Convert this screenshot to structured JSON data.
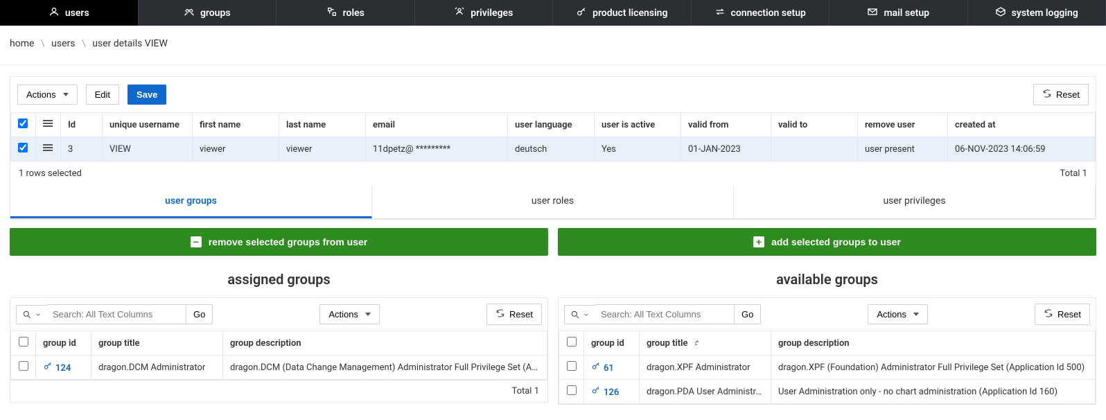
{
  "nav": {
    "items": [
      {
        "label": "users",
        "active": true
      },
      {
        "label": "groups"
      },
      {
        "label": "roles"
      },
      {
        "label": "privileges"
      },
      {
        "label": "product licensing"
      },
      {
        "label": "connection setup"
      },
      {
        "label": "mail setup"
      },
      {
        "label": "system logging"
      }
    ]
  },
  "breadcrumb": {
    "home": "home",
    "users": "users",
    "current": "user details VIEW"
  },
  "toolbar": {
    "actions": "Actions",
    "edit": "Edit",
    "save": "Save",
    "reset": "Reset"
  },
  "user_table": {
    "headers": {
      "id": "Id",
      "username": "unique username",
      "first": "first name",
      "last": "last name",
      "email": "email",
      "lang": "user language",
      "active": "user is active",
      "from": "valid from",
      "to": "valid to",
      "remove": "remove user",
      "created": "created at"
    },
    "row": {
      "id": "3",
      "username": "VIEW",
      "first": "viewer",
      "last": "viewer",
      "email": "11dpetz@ *********",
      "lang": "deutsch",
      "active": "Yes",
      "from": "01-JAN-2023",
      "to": "",
      "remove": "user present",
      "created": "06-NOV-2023 14:06:59"
    },
    "status_left": "1 rows selected",
    "status_right": "Total 1"
  },
  "subtabs": {
    "groups": "user groups",
    "roles": "user roles",
    "privileges": "user privileges"
  },
  "green": {
    "remove": "remove selected groups from user",
    "add": "add selected groups to user"
  },
  "assigned": {
    "title": "assigned groups",
    "search_placeholder": "Search: All Text Columns",
    "go": "Go",
    "actions": "Actions",
    "reset": "Reset",
    "headers": {
      "id": "group id",
      "title": "group title",
      "desc": "group description"
    },
    "rows": [
      {
        "id": "124",
        "title": "dragon.DCM Administrator",
        "desc": "dragon.DCM (Data Change Management) Administrator Full Privilege Set (Ap..."
      }
    ],
    "footer": "Total 1"
  },
  "available": {
    "title": "available groups",
    "search_placeholder": "Search: All Text Columns",
    "go": "Go",
    "actions": "Actions",
    "reset": "Reset",
    "headers": {
      "id": "group id",
      "title": "group title",
      "desc": "group description"
    },
    "rows": [
      {
        "id": "61",
        "title": "dragon.XPF Administrator",
        "desc": "dragon.XPF (Foundation) Administrator Full Privilege Set (Application Id 500)"
      },
      {
        "id": "126",
        "title": "dragon.PDA User Administrator",
        "desc": "User Administration only - no chart administration (Application Id 160)"
      }
    ]
  }
}
